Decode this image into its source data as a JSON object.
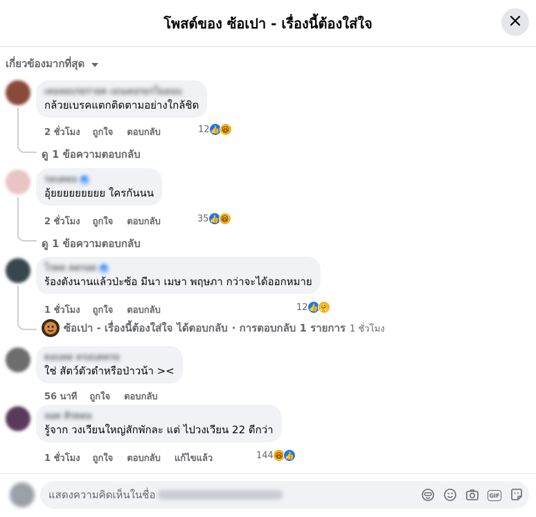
{
  "header": {
    "title": "โพสต์ของ ซ้อเปา - เรื่องนี้ต้องใส่ใจ"
  },
  "sort": {
    "label": "เกี่ยวข้องมากที่สุด"
  },
  "comments": [
    {
      "author": "เคอลอบรยรายค เอนเดอรอรโมอนบ",
      "text": "กล้วยเบรคแตกติดตามอย่างใกล้ชิด",
      "time": "2 ชั่วโมง",
      "like": "ถูกใจ",
      "reply": "ตอบกลับ",
      "reaction_count": "12",
      "reactions": [
        "like",
        "haha"
      ],
      "view_replies": "ดู 1 ข้อความตอบกลับ"
    },
    {
      "author": "รอบดดอ",
      "text": "อุ้ยยยยยยยยย ใครกันนน",
      "time": "2 ชั่วโมง",
      "like": "ถูกใจ",
      "reply": "ตอบกลับ",
      "reaction_count": "35",
      "reactions": [
        "like",
        "haha"
      ],
      "view_replies": "ดู 1 ข้อความตอบกลับ"
    },
    {
      "author": "โรดด ดดรอด",
      "text": "ร้องตังนานแล้วป่ะซ้อ มีนา เมษา พฤษภา กว่าจะได้ออกหมาย",
      "time": "1 ชั่วโมง",
      "like": "ถูกใจ",
      "reply": "ตอบกลับ",
      "reaction_count": "12",
      "reactions": [
        "like",
        "care"
      ],
      "reply_preview": {
        "name": "ซ้อเปา - เรื่องนี้ต้องใส่ใจ",
        "action": "ได้ตอบกลับ",
        "summary": "· การตอบกลับ 1 รายการ",
        "time": "1 ชั่วโมง"
      }
    },
    {
      "author": "ดอบดด ดรอบดดรอ",
      "text": "ใช่ สัตว์ตัวดำหรือป่าวน้า ><",
      "time": "56 นาที",
      "like": "ถูกใจ",
      "reply": "ตอบกลับ"
    },
    {
      "author": "ลอด ดิรดดอ",
      "text": "รู้จาก วงเวียนใหญ่สักพักละ แต่ ไปวงเวียน 22 ดีกว่า",
      "time": "1 ชั่วโมง",
      "like": "ถูกใจ",
      "reply": "ตอบกลับ",
      "edited": "แก้ไขแล้ว",
      "reaction_count": "144",
      "reactions": [
        "haha",
        "like"
      ]
    }
  ],
  "composer": {
    "placeholder": "แสดงความคิดเห็นในชื่อ"
  },
  "colors": {
    "accent": "#1877f2",
    "muted": "#65676b",
    "bubble": "#f0f2f5"
  }
}
